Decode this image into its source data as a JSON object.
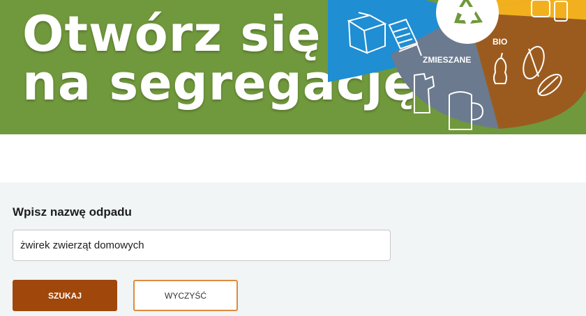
{
  "banner": {
    "headline_line1": "Otwórz się",
    "headline_line2": "na segregację!",
    "segments": {
      "mixed_label": "ZMIESZANE",
      "bio_label": "BIO"
    },
    "colors": {
      "background": "#70983c",
      "paper": "#1f8ed3",
      "plastic": "#f2b01e",
      "mixed": "#6b7a8f",
      "bio": "#9b5b1f",
      "center": "#ffffff",
      "recycle": "#70983c"
    },
    "icons": [
      "recycle-icon",
      "box-icon",
      "papers-icon",
      "jar-icon",
      "broken-glass-icon",
      "mug-icon",
      "apple-core-icon",
      "leaf-icon"
    ]
  },
  "form": {
    "label": "Wpisz nazwę odpadu",
    "search_value": "żwirek zwierząt domowych",
    "search_button": "SZUKAJ",
    "clear_button": "WYCZYŚĆ",
    "colors": {
      "panel": "#f1f5f6",
      "primary": "#a0470b",
      "outline": "#e08a3c"
    }
  }
}
